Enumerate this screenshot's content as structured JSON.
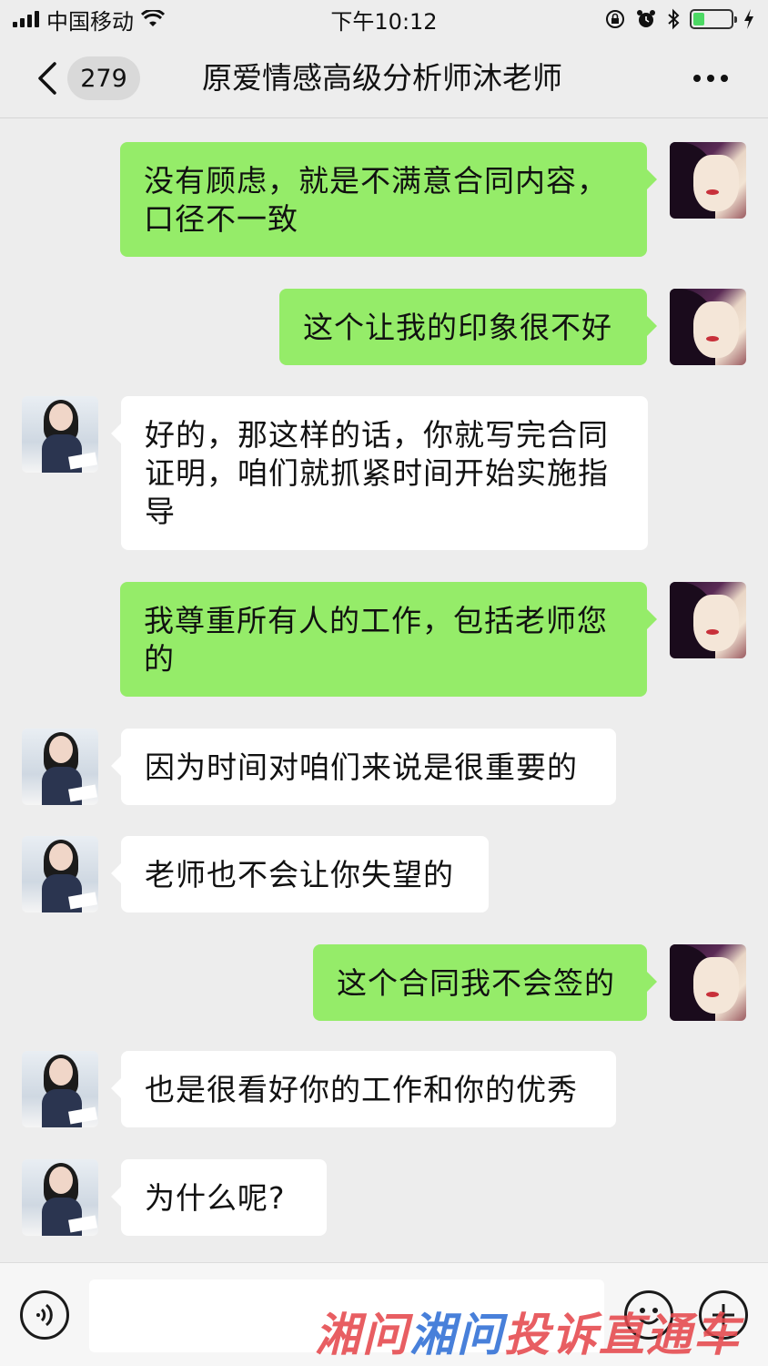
{
  "status_bar": {
    "carrier": "中国移动",
    "time": "下午10:12",
    "battery_level": 0.3,
    "icons": [
      "signal-icon",
      "wifi-icon",
      "orientation-lock-icon",
      "alarm-icon",
      "bluetooth-icon",
      "battery-icon",
      "charging-icon"
    ]
  },
  "nav": {
    "unread_count": "279",
    "title": "原爱情感高级分析师沐老师",
    "icons": [
      "back-chevron-icon",
      "more-dots-icon"
    ]
  },
  "messages": [
    {
      "side": "out",
      "text": "没有顾虑，就是不满意合同内容，口径不一致"
    },
    {
      "side": "out",
      "text": "这个让我的印象很不好"
    },
    {
      "side": "in",
      "text": "好的，那这样的话，你就写完合同证明，咱们就抓紧时间开始实施指导"
    },
    {
      "side": "out",
      "text": "我尊重所有人的工作，包括老师您的"
    },
    {
      "side": "in",
      "text": "因为时间对咱们来说是很重要的"
    },
    {
      "side": "in",
      "text": "老师也不会让你失望的"
    },
    {
      "side": "out",
      "text": "这个合同我不会签的"
    },
    {
      "side": "in",
      "text": "也是很看好你的工作和你的优秀"
    },
    {
      "side": "in",
      "text": "为什么呢?"
    }
  ],
  "input_bar": {
    "value": "",
    "icons": [
      "voice-icon",
      "emoji-icon",
      "plus-icon"
    ]
  },
  "watermark": {
    "part1": "湘问",
    "part2": "湘问",
    "part3": "投诉直通车"
  },
  "colors": {
    "background": "#ededed",
    "outgoing_bubble": "#95ec69",
    "incoming_bubble": "#ffffff",
    "battery_fill": "#4cd964"
  }
}
